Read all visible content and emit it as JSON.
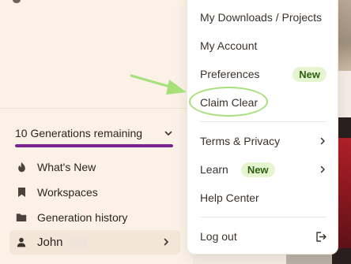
{
  "sidebar": {
    "generations_label": "10 Generations remaining",
    "generations_fraction": 1.0,
    "items": [
      {
        "label": "What's New",
        "icon": "flame-icon"
      },
      {
        "label": "Workspaces",
        "icon": "bookmark-icon"
      },
      {
        "label": "Generation history",
        "icon": "folder-icon"
      }
    ],
    "user": {
      "name": "John",
      "icon": "person-icon"
    }
  },
  "menu": {
    "my_downloads": "My Downloads / Projects",
    "my_account": "My Account",
    "preferences": "Preferences",
    "preferences_badge": "New",
    "claim_clear": "Claim Clear",
    "terms_privacy": "Terms & Privacy",
    "learn": "Learn",
    "learn_badge": "New",
    "help_center": "Help Center",
    "log_out": "Log out"
  },
  "colors": {
    "progress_accent": "#7b2290",
    "new_badge_bg": "#e5f5cf",
    "new_badge_text": "#2f5f13",
    "annotation_green": "#a6e07a"
  }
}
